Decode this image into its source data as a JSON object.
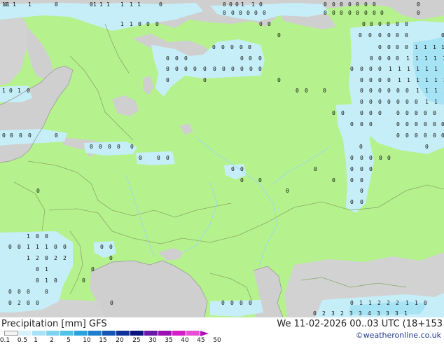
{
  "legend": {
    "title_prefix": "Precipitation [mm]",
    "model": "GFS",
    "datetime": "We 11-02-2026 00..03 UTC (18+153",
    "credit": "©weatheronline.co.uk",
    "ticks": [
      "0.1",
      "0.5",
      "1",
      "2",
      "5",
      "10",
      "15",
      "20",
      "25",
      "30",
      "35",
      "40",
      "45",
      "50"
    ],
    "swatches": [
      "#f5f5f5",
      "#d6f1fb",
      "#a9e2f6",
      "#7dd3f0",
      "#4fc3ea",
      "#2aa2df",
      "#1e7dcc",
      "#1556b5",
      "#0f319a",
      "#0a1380",
      "#6a18a8",
      "#9b0fb3",
      "#d61ec8",
      "#e64fd4"
    ],
    "arrow_color": "#b30dbb"
  },
  "colors": {
    "land_green": "#b5f28d",
    "land_gray": "#d2d2d2",
    "sea": "#cfcfcf",
    "precip_light": "#c6eef8",
    "precip_medium": "#a6e3f4",
    "border": "#8aa86a",
    "coast": "#9a9a9a"
  },
  "precip_labels": [
    {
      "t": "1",
      "gx": 3,
      "gy": 9
    },
    {
      "t": "0",
      "gx": 6,
      "gy": 9
    },
    {
      "t": "1",
      "gx": 9,
      "gy": 9
    },
    {
      "t": "1",
      "gx": 18,
      "gy": 9
    },
    {
      "t": "1",
      "gx": 40,
      "gy": 9
    },
    {
      "t": "0",
      "gx": 78,
      "gy": 9
    },
    {
      "t": "0",
      "gx": 128,
      "gy": 9
    },
    {
      "t": "1",
      "gx": 133,
      "gy": 9
    },
    {
      "t": "1",
      "gx": 142,
      "gy": 9
    },
    {
      "t": "1",
      "gx": 152,
      "gy": 9
    },
    {
      "t": "1",
      "gx": 172,
      "gy": 9
    },
    {
      "t": "1",
      "gx": 185,
      "gy": 9
    },
    {
      "t": "1",
      "gx": 196,
      "gy": 9
    },
    {
      "t": "0",
      "gx": 227,
      "gy": 9
    },
    {
      "t": "0",
      "gx": 318,
      "gy": 9
    },
    {
      "t": "0",
      "gx": 327,
      "gy": 9
    },
    {
      "t": "0",
      "gx": 336,
      "gy": 9
    },
    {
      "t": "1",
      "gx": 344,
      "gy": 9
    },
    {
      "t": "1",
      "gx": 359,
      "gy": 9
    },
    {
      "t": "0",
      "gx": 370,
      "gy": 9
    },
    {
      "t": "0",
      "gx": 462,
      "gy": 9
    },
    {
      "t": "0",
      "gx": 474,
      "gy": 9
    },
    {
      "t": "0",
      "gx": 485,
      "gy": 9
    },
    {
      "t": "0",
      "gx": 497,
      "gy": 9
    },
    {
      "t": "0",
      "gx": 508,
      "gy": 9
    },
    {
      "t": "0",
      "gx": 520,
      "gy": 9
    },
    {
      "t": "0",
      "gx": 532,
      "gy": 9
    },
    {
      "t": "0",
      "gx": 595,
      "gy": 9
    },
    {
      "t": "0",
      "gx": 318,
      "gy": 21
    },
    {
      "t": "0",
      "gx": 330,
      "gy": 21
    },
    {
      "t": "0",
      "gx": 341,
      "gy": 21
    },
    {
      "t": "0",
      "gx": 352,
      "gy": 21
    },
    {
      "t": "0",
      "gx": 363,
      "gy": 21
    },
    {
      "t": "0",
      "gx": 375,
      "gy": 21
    },
    {
      "t": "0",
      "gx": 462,
      "gy": 21
    },
    {
      "t": "0",
      "gx": 474,
      "gy": 21
    },
    {
      "t": "0",
      "gx": 485,
      "gy": 21
    },
    {
      "t": "0",
      "gx": 497,
      "gy": 21
    },
    {
      "t": "0",
      "gx": 508,
      "gy": 21
    },
    {
      "t": "0",
      "gx": 520,
      "gy": 21
    },
    {
      "t": "0",
      "gx": 532,
      "gy": 21
    },
    {
      "t": "0",
      "gx": 543,
      "gy": 21
    },
    {
      "t": "0",
      "gx": 595,
      "gy": 21
    },
    {
      "t": "1",
      "gx": 172,
      "gy": 37
    },
    {
      "t": "1",
      "gx": 185,
      "gy": 37
    },
    {
      "t": "0",
      "gx": 197,
      "gy": 37
    },
    {
      "t": "0",
      "gx": 209,
      "gy": 37
    },
    {
      "t": "0",
      "gx": 222,
      "gy": 37
    },
    {
      "t": "0",
      "gx": 370,
      "gy": 37
    },
    {
      "t": "0",
      "gx": 382,
      "gy": 37
    },
    {
      "t": "0",
      "gx": 517,
      "gy": 37
    },
    {
      "t": "0",
      "gx": 528,
      "gy": 37
    },
    {
      "t": "0",
      "gx": 540,
      "gy": 37
    },
    {
      "t": "0",
      "gx": 552,
      "gy": 37
    },
    {
      "t": "0",
      "gx": 565,
      "gy": 37
    },
    {
      "t": "0",
      "gx": 578,
      "gy": 37
    },
    {
      "t": "0",
      "gx": 396,
      "gy": 53
    },
    {
      "t": "0",
      "gx": 512,
      "gy": 53
    },
    {
      "t": "0",
      "gx": 526,
      "gy": 53
    },
    {
      "t": "0",
      "gx": 540,
      "gy": 53
    },
    {
      "t": "0",
      "gx": 553,
      "gy": 53
    },
    {
      "t": "0",
      "gx": 565,
      "gy": 53
    },
    {
      "t": "0",
      "gx": 578,
      "gy": 53
    },
    {
      "t": "0",
      "gx": 630,
      "gy": 53
    },
    {
      "t": "0",
      "gx": 303,
      "gy": 70
    },
    {
      "t": "0",
      "gx": 316,
      "gy": 70
    },
    {
      "t": "0",
      "gx": 329,
      "gy": 70
    },
    {
      "t": "0",
      "gx": 342,
      "gy": 70
    },
    {
      "t": "0",
      "gx": 354,
      "gy": 70
    },
    {
      "t": "0",
      "gx": 540,
      "gy": 70
    },
    {
      "t": "0",
      "gx": 553,
      "gy": 70
    },
    {
      "t": "0",
      "gx": 565,
      "gy": 70
    },
    {
      "t": "0",
      "gx": 578,
      "gy": 70
    },
    {
      "t": "1",
      "gx": 592,
      "gy": 70
    },
    {
      "t": "1",
      "gx": 605,
      "gy": 70
    },
    {
      "t": "1",
      "gx": 618,
      "gy": 70
    },
    {
      "t": "1",
      "gx": 630,
      "gy": 70
    },
    {
      "t": "0",
      "gx": 237,
      "gy": 86
    },
    {
      "t": "0",
      "gx": 250,
      "gy": 86
    },
    {
      "t": "0",
      "gx": 263,
      "gy": 86
    },
    {
      "t": "0",
      "gx": 343,
      "gy": 86
    },
    {
      "t": "0",
      "gx": 355,
      "gy": 86
    },
    {
      "t": "0",
      "gx": 369,
      "gy": 86
    },
    {
      "t": "0",
      "gx": 528,
      "gy": 86
    },
    {
      "t": "0",
      "gx": 540,
      "gy": 86
    },
    {
      "t": "0",
      "gx": 553,
      "gy": 86
    },
    {
      "t": "0",
      "gx": 565,
      "gy": 86
    },
    {
      "t": "1",
      "gx": 580,
      "gy": 86
    },
    {
      "t": "1",
      "gx": 593,
      "gy": 86
    },
    {
      "t": "1",
      "gx": 606,
      "gy": 86
    },
    {
      "t": "1",
      "gx": 619,
      "gy": 86
    },
    {
      "t": "1",
      "gx": 632,
      "gy": 86
    },
    {
      "t": "0",
      "gx": 237,
      "gy": 101
    },
    {
      "t": "0",
      "gx": 250,
      "gy": 101
    },
    {
      "t": "0",
      "gx": 263,
      "gy": 101
    },
    {
      "t": "0",
      "gx": 276,
      "gy": 101
    },
    {
      "t": "0",
      "gx": 290,
      "gy": 101
    },
    {
      "t": "0",
      "gx": 304,
      "gy": 101
    },
    {
      "t": "0",
      "gx": 317,
      "gy": 101
    },
    {
      "t": "0",
      "gx": 330,
      "gy": 101
    },
    {
      "t": "0",
      "gx": 343,
      "gy": 101
    },
    {
      "t": "0",
      "gx": 356,
      "gy": 101
    },
    {
      "t": "0",
      "gx": 369,
      "gy": 101
    },
    {
      "t": "0",
      "gx": 500,
      "gy": 101
    },
    {
      "t": "0",
      "gx": 514,
      "gy": 101
    },
    {
      "t": "0",
      "gx": 527,
      "gy": 101
    },
    {
      "t": "0",
      "gx": 540,
      "gy": 101
    },
    {
      "t": "1",
      "gx": 555,
      "gy": 101
    },
    {
      "t": "1",
      "gx": 568,
      "gy": 101
    },
    {
      "t": "1",
      "gx": 581,
      "gy": 101
    },
    {
      "t": "1",
      "gx": 594,
      "gy": 101
    },
    {
      "t": "1",
      "gx": 607,
      "gy": 101
    },
    {
      "t": "1",
      "gx": 620,
      "gy": 101
    },
    {
      "t": "1",
      "gx": 633,
      "gy": 101
    },
    {
      "t": "0",
      "gx": 237,
      "gy": 117
    },
    {
      "t": "0",
      "gx": 290,
      "gy": 117
    },
    {
      "t": "0",
      "gx": 396,
      "gy": 117
    },
    {
      "t": "0",
      "gx": 514,
      "gy": 117
    },
    {
      "t": "0",
      "gx": 527,
      "gy": 117
    },
    {
      "t": "0",
      "gx": 540,
      "gy": 117
    },
    {
      "t": "0",
      "gx": 553,
      "gy": 117
    },
    {
      "t": "1",
      "gx": 568,
      "gy": 117
    },
    {
      "t": "1",
      "gx": 581,
      "gy": 117
    },
    {
      "t": "1",
      "gx": 594,
      "gy": 117
    },
    {
      "t": "1",
      "gx": 607,
      "gy": 117
    },
    {
      "t": "1",
      "gx": 620,
      "gy": 117
    },
    {
      "t": "2",
      "gx": 633,
      "gy": 117
    },
    {
      "t": "1",
      "gx": 3,
      "gy": 132
    },
    {
      "t": "0",
      "gx": 13,
      "gy": 132
    },
    {
      "t": "1",
      "gx": 25,
      "gy": 132
    },
    {
      "t": "0",
      "gx": 38,
      "gy": 132
    },
    {
      "t": "0",
      "gx": 422,
      "gy": 132
    },
    {
      "t": "0",
      "gx": 435,
      "gy": 132
    },
    {
      "t": "0",
      "gx": 461,
      "gy": 132
    },
    {
      "t": "0",
      "gx": 514,
      "gy": 132
    },
    {
      "t": "0",
      "gx": 527,
      "gy": 132
    },
    {
      "t": "0",
      "gx": 540,
      "gy": 132
    },
    {
      "t": "0",
      "gx": 553,
      "gy": 132
    },
    {
      "t": "0",
      "gx": 566,
      "gy": 132
    },
    {
      "t": "0",
      "gx": 579,
      "gy": 132
    },
    {
      "t": "1",
      "gx": 594,
      "gy": 132
    },
    {
      "t": "1",
      "gx": 607,
      "gy": 132
    },
    {
      "t": "1",
      "gx": 620,
      "gy": 132
    },
    {
      "t": "1",
      "gx": 633,
      "gy": 132
    },
    {
      "t": "0",
      "gx": 514,
      "gy": 148
    },
    {
      "t": "0",
      "gx": 527,
      "gy": 148
    },
    {
      "t": "0",
      "gx": 540,
      "gy": 148
    },
    {
      "t": "0",
      "gx": 553,
      "gy": 148
    },
    {
      "t": "0",
      "gx": 566,
      "gy": 148
    },
    {
      "t": "0",
      "gx": 579,
      "gy": 148
    },
    {
      "t": "0",
      "gx": 592,
      "gy": 148
    },
    {
      "t": "1",
      "gx": 607,
      "gy": 148
    },
    {
      "t": "1",
      "gx": 620,
      "gy": 148
    },
    {
      "t": "1",
      "gx": 633,
      "gy": 148
    },
    {
      "t": "0",
      "gx": 474,
      "gy": 164
    },
    {
      "t": "0",
      "gx": 487,
      "gy": 164
    },
    {
      "t": "0",
      "gx": 514,
      "gy": 164
    },
    {
      "t": "0",
      "gx": 527,
      "gy": 164
    },
    {
      "t": "0",
      "gx": 540,
      "gy": 164
    },
    {
      "t": "0",
      "gx": 566,
      "gy": 164
    },
    {
      "t": "0",
      "gx": 579,
      "gy": 164
    },
    {
      "t": "0",
      "gx": 592,
      "gy": 164
    },
    {
      "t": "0",
      "gx": 605,
      "gy": 164
    },
    {
      "t": "0",
      "gx": 618,
      "gy": 164
    },
    {
      "t": "1",
      "gx": 633,
      "gy": 164
    },
    {
      "t": "0",
      "gx": 500,
      "gy": 180
    },
    {
      "t": "0",
      "gx": 514,
      "gy": 180
    },
    {
      "t": "0",
      "gx": 527,
      "gy": 180
    },
    {
      "t": "0",
      "gx": 566,
      "gy": 180
    },
    {
      "t": "0",
      "gx": 579,
      "gy": 180
    },
    {
      "t": "0",
      "gx": 592,
      "gy": 180
    },
    {
      "t": "0",
      "gx": 605,
      "gy": 180
    },
    {
      "t": "0",
      "gx": 618,
      "gy": 180
    },
    {
      "t": "0",
      "gx": 630,
      "gy": 180
    },
    {
      "t": "0",
      "gx": 3,
      "gy": 196
    },
    {
      "t": "0",
      "gx": 14,
      "gy": 196
    },
    {
      "t": "0",
      "gx": 27,
      "gy": 196
    },
    {
      "t": "0",
      "gx": 40,
      "gy": 196
    },
    {
      "t": "0",
      "gx": 78,
      "gy": 196
    },
    {
      "t": "0",
      "gx": 566,
      "gy": 196
    },
    {
      "t": "0",
      "gx": 579,
      "gy": 196
    },
    {
      "t": "0",
      "gx": 592,
      "gy": 196
    },
    {
      "t": "0",
      "gx": 605,
      "gy": 196
    },
    {
      "t": "0",
      "gx": 618,
      "gy": 196
    },
    {
      "t": "0",
      "gx": 630,
      "gy": 196
    },
    {
      "t": "0",
      "gx": 128,
      "gy": 212
    },
    {
      "t": "0",
      "gx": 141,
      "gy": 212
    },
    {
      "t": "0",
      "gx": 154,
      "gy": 212
    },
    {
      "t": "0",
      "gx": 167,
      "gy": 212
    },
    {
      "t": "0",
      "gx": 186,
      "gy": 212
    },
    {
      "t": "0",
      "gx": 513,
      "gy": 212
    },
    {
      "t": "0",
      "gx": 607,
      "gy": 212
    },
    {
      "t": "0",
      "gx": 198,
      "gy": 228
    },
    {
      "t": "0",
      "gx": 224,
      "gy": 228
    },
    {
      "t": "0",
      "gx": 237,
      "gy": 228
    },
    {
      "t": "0",
      "gx": 500,
      "gy": 228
    },
    {
      "t": "0",
      "gx": 514,
      "gy": 228
    },
    {
      "t": "0",
      "gx": 527,
      "gy": 228
    },
    {
      "t": "0",
      "gx": 541,
      "gy": 228
    },
    {
      "t": "0",
      "gx": 553,
      "gy": 228
    },
    {
      "t": "0",
      "gx": 330,
      "gy": 244
    },
    {
      "t": "0",
      "gx": 343,
      "gy": 244
    },
    {
      "t": "0",
      "gx": 448,
      "gy": 244
    },
    {
      "t": "0",
      "gx": 500,
      "gy": 244
    },
    {
      "t": "0",
      "gx": 514,
      "gy": 244
    },
    {
      "t": "0",
      "gx": 527,
      "gy": 244
    },
    {
      "t": "0",
      "gx": 343,
      "gy": 260
    },
    {
      "t": "0",
      "gx": 369,
      "gy": 260
    },
    {
      "t": "0",
      "gx": 474,
      "gy": 260
    },
    {
      "t": "0",
      "gx": 500,
      "gy": 260
    },
    {
      "t": "0",
      "gx": 514,
      "gy": 260
    },
    {
      "t": "0",
      "gx": 52,
      "gy": 275
    },
    {
      "t": "0",
      "gx": 408,
      "gy": 275
    },
    {
      "t": "0",
      "gx": 514,
      "gy": 275
    },
    {
      "t": "0",
      "gx": 500,
      "gy": 291
    },
    {
      "t": "0",
      "gx": 514,
      "gy": 291
    },
    {
      "t": "1",
      "gx": 38,
      "gy": 340
    },
    {
      "t": "0",
      "gx": 51,
      "gy": 340
    },
    {
      "t": "0",
      "gx": 64,
      "gy": 340
    },
    {
      "t": "0",
      "gx": 12,
      "gy": 355
    },
    {
      "t": "0",
      "gx": 25,
      "gy": 355
    },
    {
      "t": "1",
      "gx": 38,
      "gy": 355
    },
    {
      "t": "1",
      "gx": 51,
      "gy": 355
    },
    {
      "t": "1",
      "gx": 64,
      "gy": 355
    },
    {
      "t": "0",
      "gx": 77,
      "gy": 355
    },
    {
      "t": "0",
      "gx": 90,
      "gy": 355
    },
    {
      "t": "0",
      "gx": 143,
      "gy": 355
    },
    {
      "t": "0",
      "gx": 156,
      "gy": 355
    },
    {
      "t": "1",
      "gx": 38,
      "gy": 371
    },
    {
      "t": "2",
      "gx": 51,
      "gy": 371
    },
    {
      "t": "0",
      "gx": 64,
      "gy": 371
    },
    {
      "t": "2",
      "gx": 77,
      "gy": 371
    },
    {
      "t": "2",
      "gx": 90,
      "gy": 371
    },
    {
      "t": "0",
      "gx": 156,
      "gy": 371
    },
    {
      "t": "0",
      "gx": 51,
      "gy": 387
    },
    {
      "t": "1",
      "gx": 64,
      "gy": 387
    },
    {
      "t": "0",
      "gx": 130,
      "gy": 387
    },
    {
      "t": "0",
      "gx": 51,
      "gy": 403
    },
    {
      "t": "1",
      "gx": 64,
      "gy": 403
    },
    {
      "t": "0",
      "gx": 77,
      "gy": 403
    },
    {
      "t": "0",
      "gx": 117,
      "gy": 403
    },
    {
      "t": "0",
      "gx": 12,
      "gy": 419
    },
    {
      "t": "0",
      "gx": 25,
      "gy": 419
    },
    {
      "t": "0",
      "gx": 38,
      "gy": 419
    },
    {
      "t": "0",
      "gx": 64,
      "gy": 419
    },
    {
      "t": "0",
      "gx": 12,
      "gy": 435
    },
    {
      "t": "2",
      "gx": 25,
      "gy": 435
    },
    {
      "t": "0",
      "gx": 38,
      "gy": 435
    },
    {
      "t": "0",
      "gx": 51,
      "gy": 435
    },
    {
      "t": "0",
      "gx": 157,
      "gy": 435
    },
    {
      "t": "0",
      "gx": 316,
      "gy": 435
    },
    {
      "t": "0",
      "gx": 329,
      "gy": 435
    },
    {
      "t": "0",
      "gx": 342,
      "gy": 435
    },
    {
      "t": "0",
      "gx": 355,
      "gy": 435
    },
    {
      "t": "0",
      "gx": 500,
      "gy": 435
    },
    {
      "t": "1",
      "gx": 513,
      "gy": 435
    },
    {
      "t": "1",
      "gx": 526,
      "gy": 435
    },
    {
      "t": "2",
      "gx": 539,
      "gy": 435
    },
    {
      "t": "2",
      "gx": 552,
      "gy": 435
    },
    {
      "t": "2",
      "gx": 565,
      "gy": 435
    },
    {
      "t": "1",
      "gx": 579,
      "gy": 435
    },
    {
      "t": "1",
      "gx": 592,
      "gy": 435
    },
    {
      "t": "0",
      "gx": 605,
      "gy": 435
    },
    {
      "t": "0",
      "gx": 447,
      "gy": 450
    },
    {
      "t": "2",
      "gx": 460,
      "gy": 450
    },
    {
      "t": "3",
      "gx": 473,
      "gy": 450
    },
    {
      "t": "2",
      "gx": 486,
      "gy": 450
    },
    {
      "t": "3",
      "gx": 499,
      "gy": 450
    },
    {
      "t": "3",
      "gx": 512,
      "gy": 450
    },
    {
      "t": "4",
      "gx": 525,
      "gy": 450
    },
    {
      "t": "3",
      "gx": 538,
      "gy": 450
    },
    {
      "t": "3",
      "gx": 551,
      "gy": 450
    },
    {
      "t": "3",
      "gx": 564,
      "gy": 450
    },
    {
      "t": "1",
      "gx": 577,
      "gy": 450
    }
  ]
}
